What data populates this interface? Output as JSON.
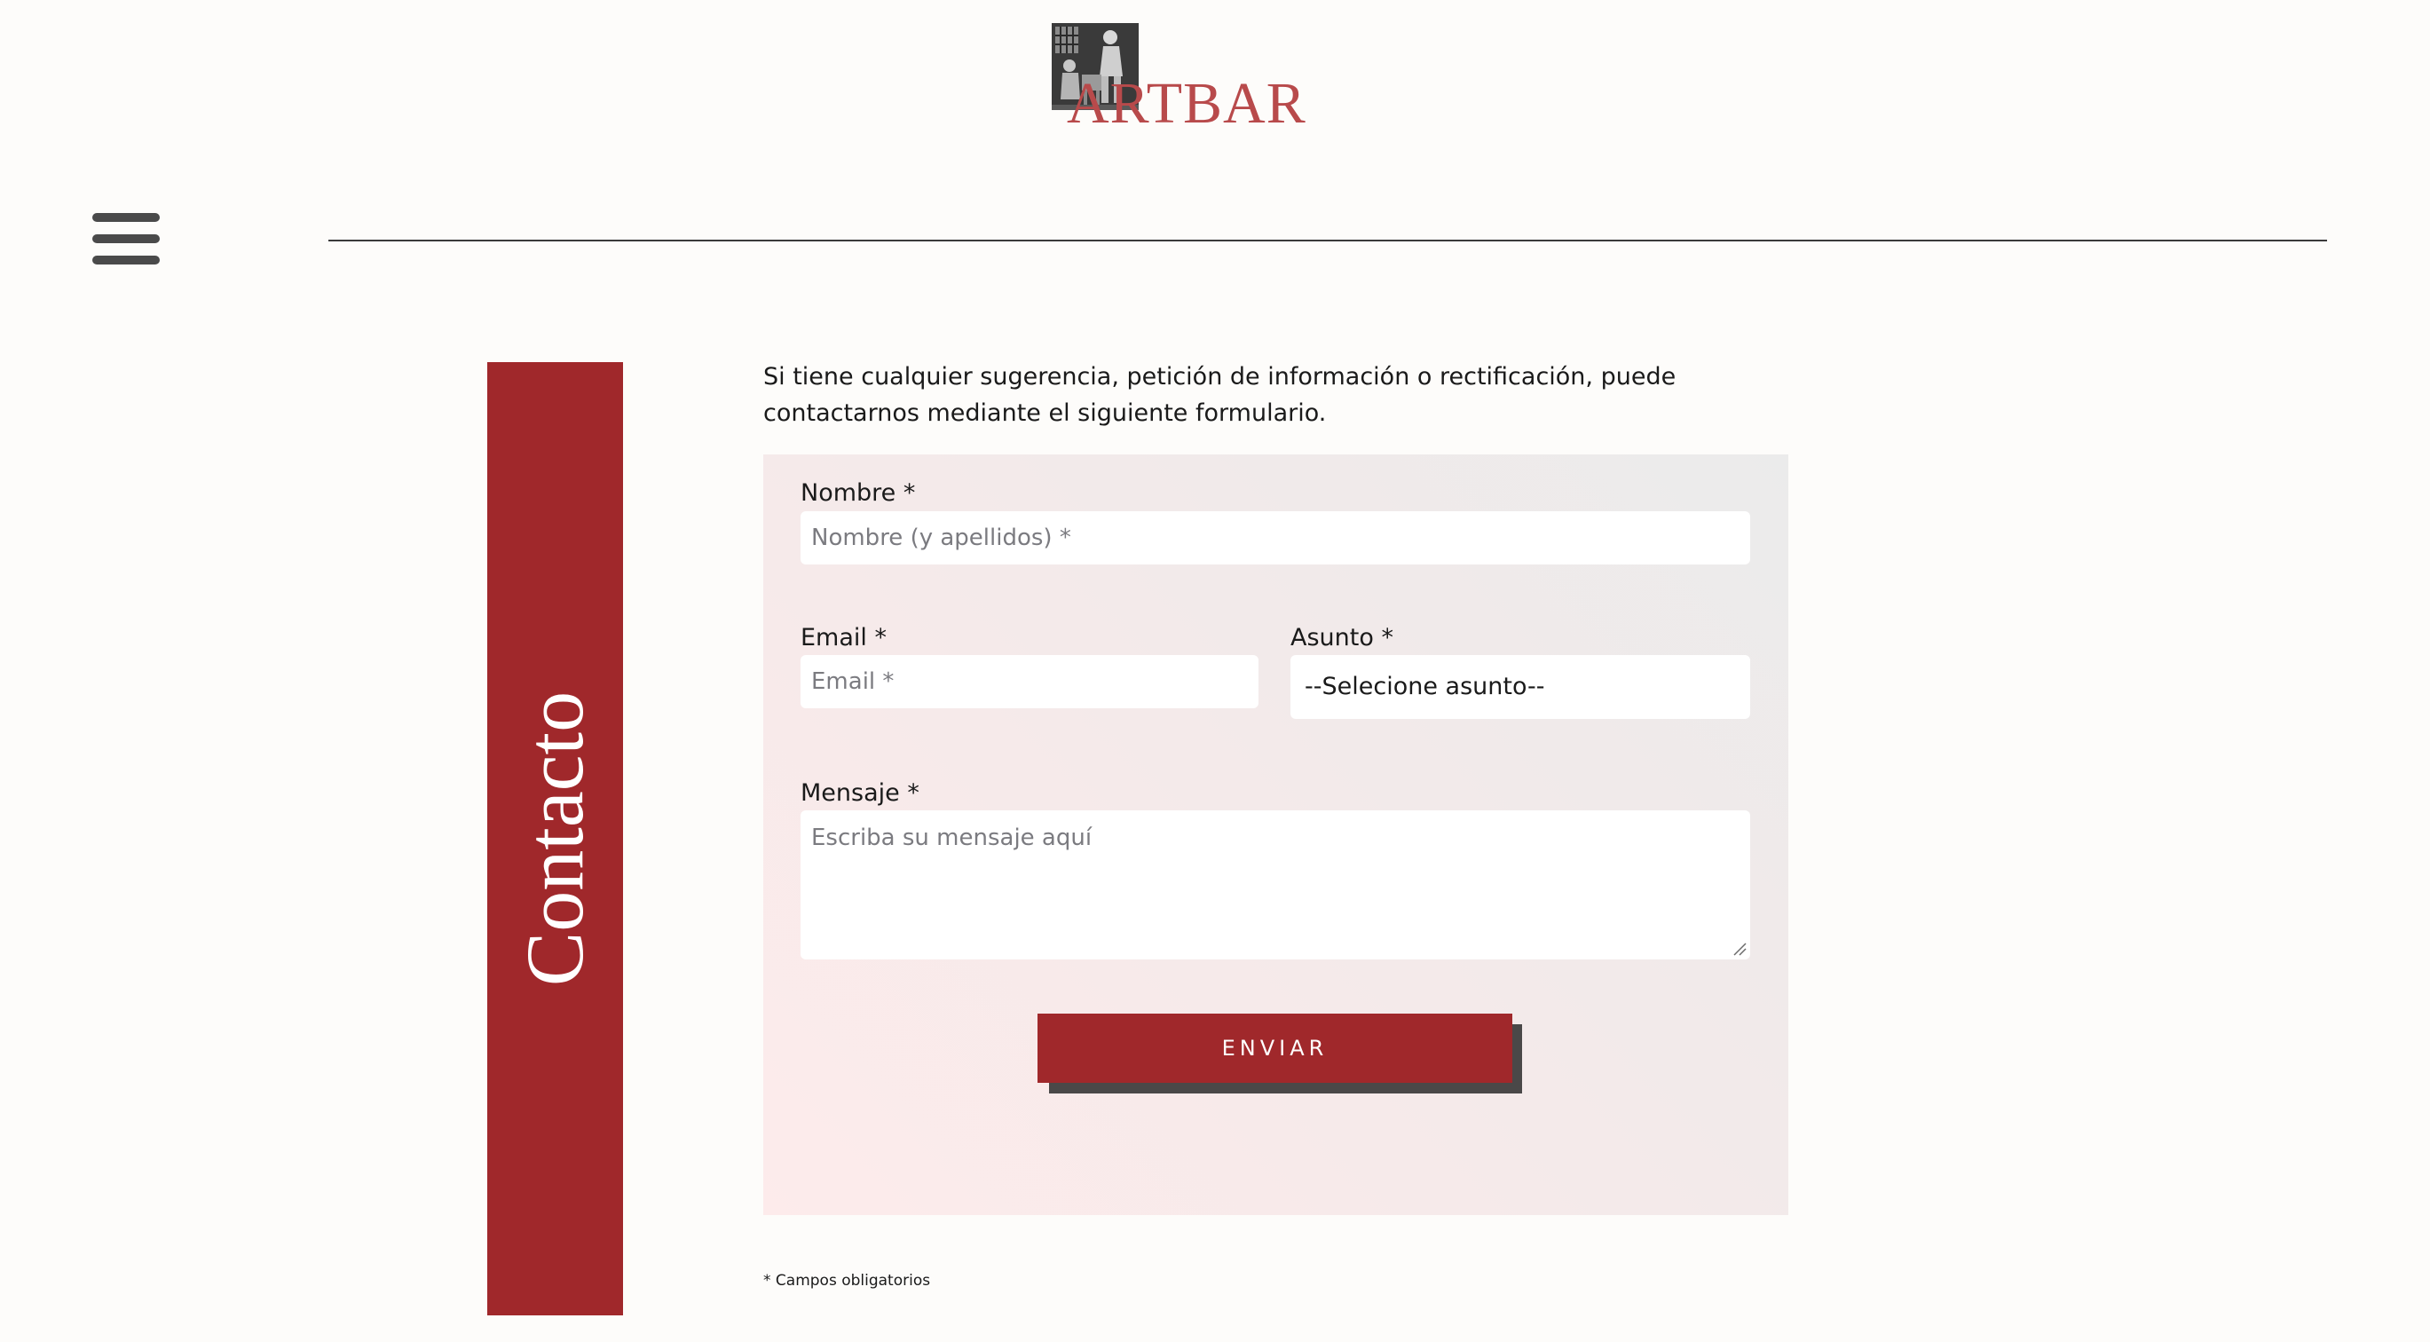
{
  "header": {
    "logo_text": "ARTBAR",
    "logo_image": "artisans-woodcut-image",
    "menu_icon": "hamburger-menu-icon"
  },
  "side_banner": {
    "title": "Contacto"
  },
  "intro": {
    "text": "Si tiene cualquier sugerencia, petición de información o rectificación, puede contactarnos mediante el siguiente formulario."
  },
  "form": {
    "name": {
      "label": "Nombre *",
      "placeholder": "Nombre (y apellidos) *",
      "value": ""
    },
    "email": {
      "label": "Email *",
      "placeholder": "Email *",
      "value": ""
    },
    "subject": {
      "label": "Asunto *",
      "selected": "--Selecione asunto--"
    },
    "message": {
      "label": "Mensaje *",
      "placeholder": "Escriba su mensaje aquí",
      "value": ""
    },
    "submit_label": "ENVIAR"
  },
  "footnote": "* Campos obligatorios",
  "colors": {
    "accent": "#a0282b",
    "logo_text": "#b84a4b",
    "background": "#fdfcfa",
    "button_shadow": "#4a4848"
  }
}
